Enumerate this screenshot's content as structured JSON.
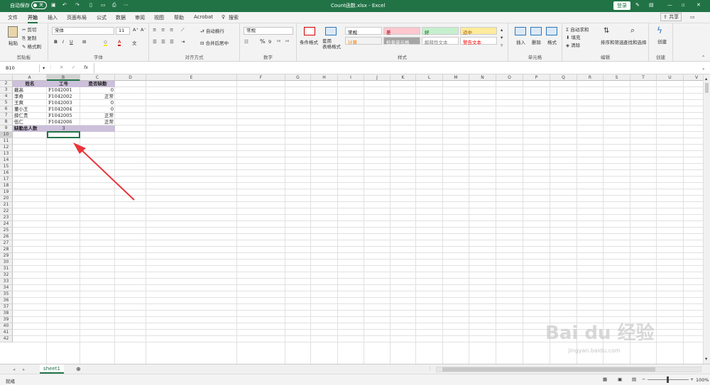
{
  "titlebar": {
    "autosave_label": "自动保存",
    "autosave_state": "关",
    "doc_title": "Count函数.xlsx  -  Excel",
    "login_label": "登录"
  },
  "menu": {
    "items": [
      "文件",
      "开始",
      "插入",
      "页面布局",
      "公式",
      "数据",
      "审阅",
      "视图",
      "帮助",
      "Acrobat"
    ],
    "active": "开始",
    "search_label": "搜索",
    "share_label": "共享"
  },
  "ribbon": {
    "clipboard": {
      "paste": "粘贴",
      "cut": "剪切",
      "copy": "复制",
      "format_painter": "格式刷",
      "label": "剪贴板"
    },
    "font": {
      "name": "宋体",
      "size": "11",
      "bold": "B",
      "italic": "I",
      "underline": "U",
      "label": "字体"
    },
    "alignment": {
      "wrap": "自动换行",
      "merge": "合并后居中",
      "label": "对齐方式"
    },
    "number": {
      "format": "常规",
      "label": "数字"
    },
    "styles": {
      "conditional": "条件格式",
      "table": "套用\n表格格式",
      "label": "样式",
      "boxes": [
        {
          "text": "常规",
          "bg": "#ffffff",
          "fg": "#000000"
        },
        {
          "text": "差",
          "bg": "#ffc7ce",
          "fg": "#9c0006"
        },
        {
          "text": "好",
          "bg": "#c6efce",
          "fg": "#006100"
        },
        {
          "text": "适中",
          "bg": "#ffeb9c",
          "fg": "#9c5700"
        },
        {
          "text": "计算",
          "bg": "#f2f2f2",
          "fg": "#fa7d00"
        },
        {
          "text": "检查单元格",
          "bg": "#a5a5a5",
          "fg": "#ffffff"
        },
        {
          "text": "解释性文本",
          "bg": "#ffffff",
          "fg": "#7f7f7f"
        },
        {
          "text": "警告文本",
          "bg": "#ffffff",
          "fg": "#ff0000"
        }
      ]
    },
    "cells": {
      "insert": "插入",
      "delete": "删除",
      "format": "格式",
      "label": "单元格"
    },
    "editing": {
      "autosum": "自动求和",
      "fill": "填充",
      "clear": "清除",
      "sort": "排序和筛选",
      "find": "查找和选择",
      "label": "编辑"
    },
    "create": {
      "label": "创建",
      "btn": "创建"
    }
  },
  "formula_bar": {
    "name_box": "B10",
    "fx": "fx",
    "formula": ""
  },
  "grid": {
    "columns": [
      "A",
      "B",
      "C",
      "D",
      "E",
      "F",
      "G",
      "H",
      "I",
      "J",
      "K",
      "L",
      "M",
      "N",
      "O",
      "P",
      "Q",
      "R",
      "S",
      "T",
      "U",
      "V"
    ],
    "rows": [
      "2",
      "3",
      "4",
      "5",
      "6",
      "7",
      "8",
      "9",
      "10",
      "11",
      "12",
      "13",
      "14",
      "15",
      "16",
      "17",
      "18",
      "19",
      "20",
      "21",
      "22",
      "23",
      "24",
      "25",
      "26",
      "27",
      "28",
      "29",
      "30",
      "31",
      "32",
      "33",
      "34",
      "35",
      "36",
      "37",
      "38",
      "39",
      "40",
      "41",
      "42"
    ],
    "header_row": [
      "姓名",
      "工号",
      "是否缺勤"
    ],
    "data": [
      [
        "戴高",
        "F1042001",
        "0"
      ],
      [
        "李奇",
        "F1042002",
        "正常"
      ],
      [
        "王爽",
        "F1042003",
        "0"
      ],
      [
        "董小王",
        "F1042004",
        "0"
      ],
      [
        "薛仁贵",
        "F1042005",
        "正常"
      ],
      [
        "伍仁",
        "F1042006",
        "正常"
      ]
    ],
    "summary": {
      "label": "缺勤总人数",
      "value": "3"
    },
    "header_fill": "#ccc0da"
  },
  "tabs": {
    "sheets": [
      "sheet1"
    ],
    "active": "sheet1"
  },
  "status": {
    "ready": "就绪",
    "zoom": "100%"
  },
  "watermark": {
    "brand": "Bai du 经验",
    "url": "jingyan.baidu.com"
  },
  "annotation": {
    "arrow_color": "#e8353b"
  }
}
